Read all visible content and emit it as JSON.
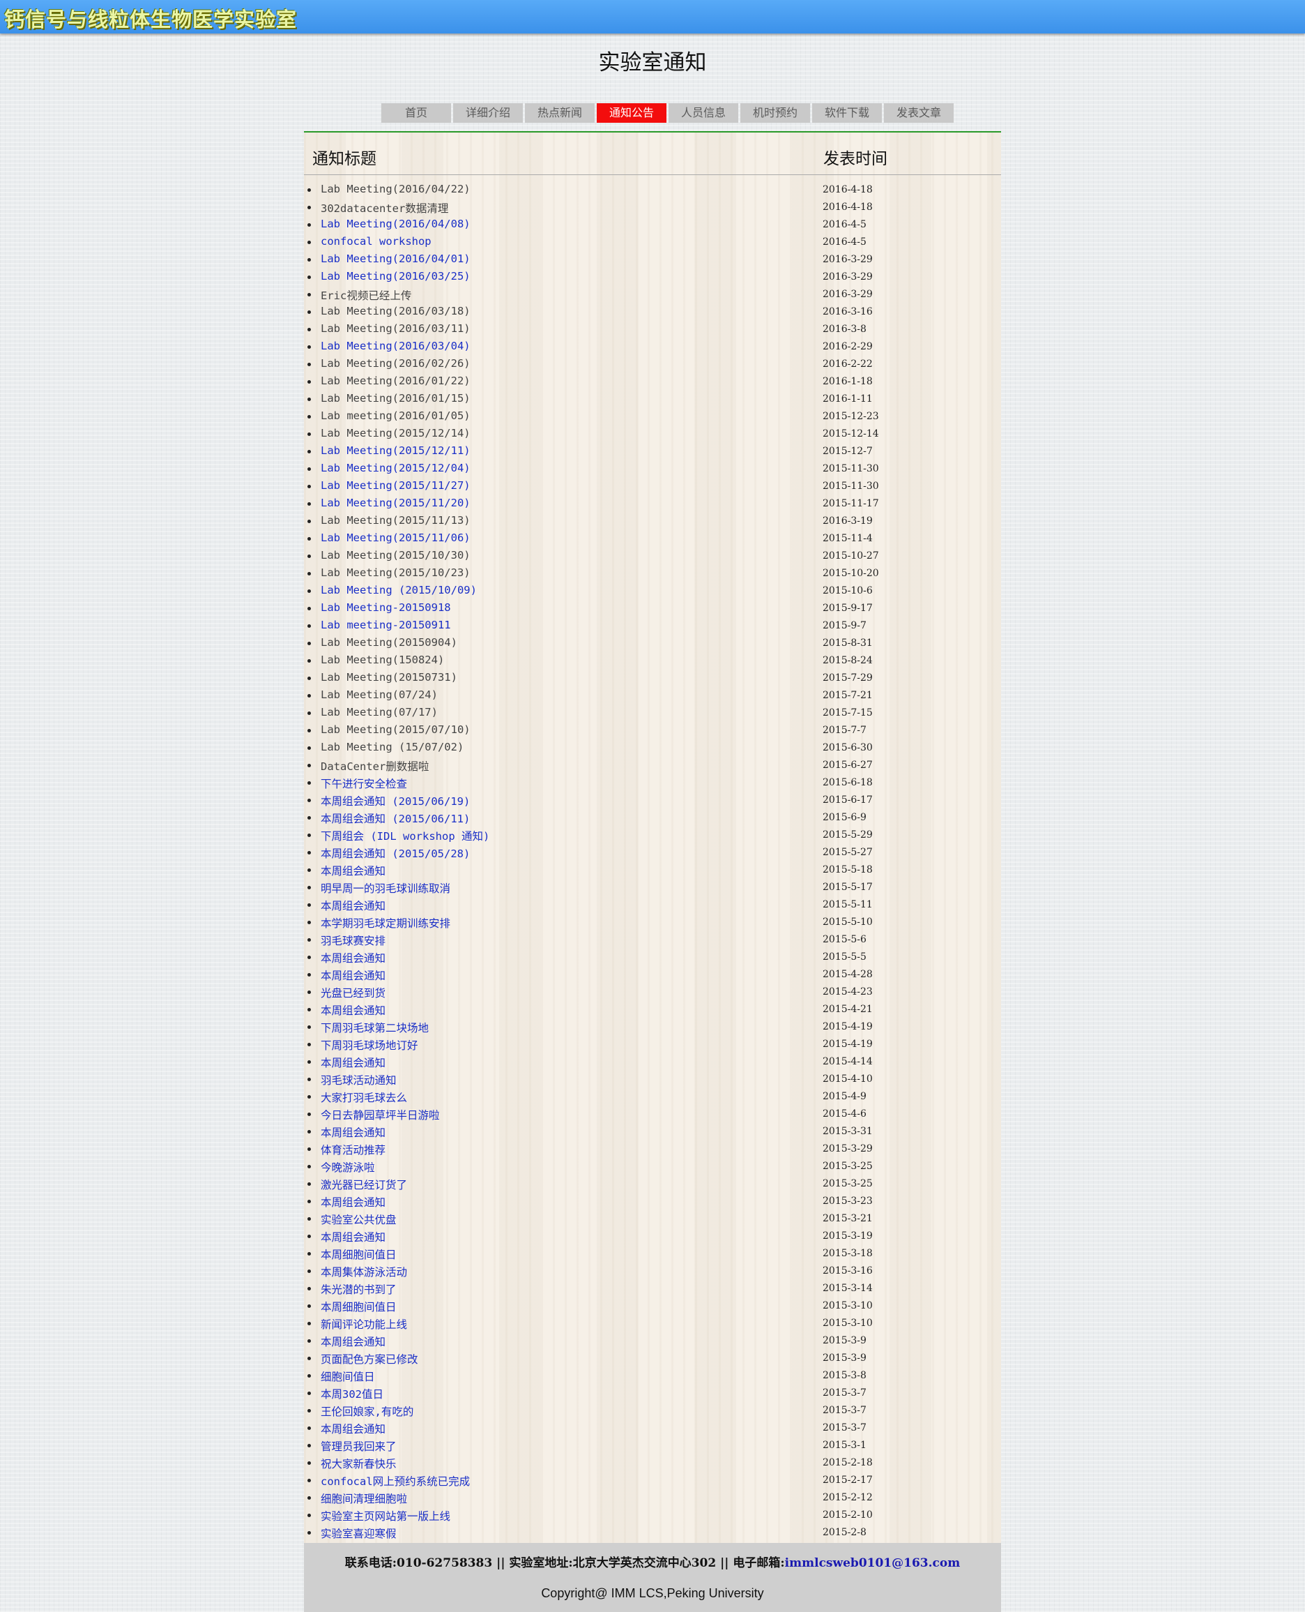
{
  "header": {
    "site_title": "钙信号与线粒体生物医学实验室"
  },
  "page_title": "实验室通知",
  "nav": [
    {
      "label": "首页",
      "active": false
    },
    {
      "label": "详细介绍",
      "active": false
    },
    {
      "label": "热点新闻",
      "active": false
    },
    {
      "label": "通知公告",
      "active": true
    },
    {
      "label": "人员信息",
      "active": false
    },
    {
      "label": "机时预约",
      "active": false
    },
    {
      "label": "软件下载",
      "active": false
    },
    {
      "label": "发表文章",
      "active": false
    }
  ],
  "table": {
    "col_title": "通知标题",
    "col_time": "发表时间"
  },
  "notices": [
    {
      "title": "Lab Meeting(2016/04/22)",
      "date": "2016-4-18",
      "link": false
    },
    {
      "title": "302datacenter数据清理",
      "date": "2016-4-18",
      "link": false
    },
    {
      "title": "Lab Meeting(2016/04/08)",
      "date": "2016-4-5",
      "link": true
    },
    {
      "title": "confocal workshop",
      "date": "2016-4-5",
      "link": true
    },
    {
      "title": "Lab Meeting(2016/04/01)",
      "date": "2016-3-29",
      "link": true
    },
    {
      "title": "Lab Meeting(2016/03/25)",
      "date": "2016-3-29",
      "link": true
    },
    {
      "title": "Eric视频已经上传",
      "date": "2016-3-29",
      "link": false
    },
    {
      "title": "Lab Meeting(2016/03/18)",
      "date": "2016-3-16",
      "link": false
    },
    {
      "title": "Lab Meeting(2016/03/11)",
      "date": "2016-3-8",
      "link": false
    },
    {
      "title": "Lab Meeting(2016/03/04)",
      "date": "2016-2-29",
      "link": true
    },
    {
      "title": "Lab Meeting(2016/02/26)",
      "date": "2016-2-22",
      "link": false
    },
    {
      "title": "Lab Meeting(2016/01/22)",
      "date": "2016-1-18",
      "link": false
    },
    {
      "title": "Lab Meeting(2016/01/15)",
      "date": "2016-1-11",
      "link": false
    },
    {
      "title": "Lab meeting(2016/01/05)",
      "date": "2015-12-23",
      "link": false
    },
    {
      "title": "Lab Meeting(2015/12/14)",
      "date": "2015-12-14",
      "link": false
    },
    {
      "title": "Lab Meeting(2015/12/11)",
      "date": "2015-12-7",
      "link": true
    },
    {
      "title": "Lab Meeting(2015/12/04)",
      "date": "2015-11-30",
      "link": true
    },
    {
      "title": "Lab Meeting(2015/11/27)",
      "date": "2015-11-30",
      "link": true
    },
    {
      "title": "Lab Meeting(2015/11/20)",
      "date": "2015-11-17",
      "link": true
    },
    {
      "title": "Lab Meeting(2015/11/13)",
      "date": "2016-3-19",
      "link": false
    },
    {
      "title": "Lab Meeting(2015/11/06)",
      "date": "2015-11-4",
      "link": true
    },
    {
      "title": "Lab Meeting(2015/10/30)",
      "date": "2015-10-27",
      "link": false
    },
    {
      "title": "Lab Meeting(2015/10/23)",
      "date": "2015-10-20",
      "link": false
    },
    {
      "title": "Lab Meeting (2015/10/09)",
      "date": "2015-10-6",
      "link": true
    },
    {
      "title": "Lab Meeting-20150918",
      "date": "2015-9-17",
      "link": true
    },
    {
      "title": "Lab meeting-20150911",
      "date": "2015-9-7",
      "link": true
    },
    {
      "title": "Lab Meeting(20150904)",
      "date": "2015-8-31",
      "link": false
    },
    {
      "title": "Lab Meeting(150824)",
      "date": "2015-8-24",
      "link": false
    },
    {
      "title": "Lab Meeting(20150731)",
      "date": "2015-7-29",
      "link": false
    },
    {
      "title": "Lab Meeting(07/24)",
      "date": "2015-7-21",
      "link": false
    },
    {
      "title": "Lab Meeting(07/17)",
      "date": "2015-7-15",
      "link": false
    },
    {
      "title": "Lab Meeting(2015/07/10)",
      "date": "2015-7-7",
      "link": false
    },
    {
      "title": "Lab Meeting (15/07/02)",
      "date": "2015-6-30",
      "link": false
    },
    {
      "title": "DataCenter删数据啦",
      "date": "2015-6-27",
      "link": false
    },
    {
      "title": "下午进行安全检查",
      "date": "2015-6-18",
      "link": true
    },
    {
      "title": "本周组会通知 (2015/06/19)",
      "date": "2015-6-17",
      "link": true
    },
    {
      "title": "本周组会通知 (2015/06/11)",
      "date": "2015-6-9",
      "link": true
    },
    {
      "title": "下周组会 (IDL workshop 通知)",
      "date": "2015-5-29",
      "link": true
    },
    {
      "title": "本周组会通知 (2015/05/28)",
      "date": "2015-5-27",
      "link": true
    },
    {
      "title": "本周组会通知",
      "date": "2015-5-18",
      "link": true
    },
    {
      "title": "明早周一的羽毛球训练取消",
      "date": "2015-5-17",
      "link": true
    },
    {
      "title": "本周组会通知",
      "date": "2015-5-11",
      "link": true
    },
    {
      "title": "本学期羽毛球定期训练安排",
      "date": "2015-5-10",
      "link": true
    },
    {
      "title": "羽毛球赛安排",
      "date": "2015-5-6",
      "link": true
    },
    {
      "title": "本周组会通知",
      "date": "2015-5-5",
      "link": true
    },
    {
      "title": "本周组会通知",
      "date": "2015-4-28",
      "link": true
    },
    {
      "title": "光盘已经到货",
      "date": "2015-4-23",
      "link": true
    },
    {
      "title": "本周组会通知",
      "date": "2015-4-21",
      "link": true
    },
    {
      "title": "下周羽毛球第二块场地",
      "date": "2015-4-19",
      "link": true
    },
    {
      "title": "下周羽毛球场地订好",
      "date": "2015-4-19",
      "link": true
    },
    {
      "title": "本周组会通知",
      "date": "2015-4-14",
      "link": true
    },
    {
      "title": "羽毛球活动通知",
      "date": "2015-4-10",
      "link": true
    },
    {
      "title": "大家打羽毛球去么",
      "date": "2015-4-9",
      "link": true
    },
    {
      "title": "今日去静园草坪半日游啦",
      "date": "2015-4-6",
      "link": true
    },
    {
      "title": "本周组会通知",
      "date": "2015-3-31",
      "link": true
    },
    {
      "title": "体育活动推荐",
      "date": "2015-3-29",
      "link": true
    },
    {
      "title": "今晚游泳啦",
      "date": "2015-3-25",
      "link": true
    },
    {
      "title": "激光器已经订货了",
      "date": "2015-3-25",
      "link": true
    },
    {
      "title": "本周组会通知",
      "date": "2015-3-23",
      "link": true
    },
    {
      "title": "实验室公共优盘",
      "date": "2015-3-21",
      "link": true
    },
    {
      "title": "本周组会通知",
      "date": "2015-3-19",
      "link": true
    },
    {
      "title": "本周细胞间值日",
      "date": "2015-3-18",
      "link": true
    },
    {
      "title": "本周集体游泳活动",
      "date": "2015-3-16",
      "link": true
    },
    {
      "title": "朱光潜的书到了",
      "date": "2015-3-14",
      "link": true
    },
    {
      "title": "本周细胞间值日",
      "date": "2015-3-10",
      "link": true
    },
    {
      "title": "新闻评论功能上线",
      "date": "2015-3-10",
      "link": true
    },
    {
      "title": "本周组会通知",
      "date": "2015-3-9",
      "link": true
    },
    {
      "title": "页面配色方案已修改",
      "date": "2015-3-9",
      "link": true
    },
    {
      "title": "细胞间值日",
      "date": "2015-3-8",
      "link": true
    },
    {
      "title": "本周302值日",
      "date": "2015-3-7",
      "link": true
    },
    {
      "title": "王伦回娘家,有吃的",
      "date": "2015-3-7",
      "link": true
    },
    {
      "title": "本周组会通知",
      "date": "2015-3-7",
      "link": true
    },
    {
      "title": "管理员我回来了",
      "date": "2015-3-1",
      "link": true
    },
    {
      "title": "祝大家新春快乐",
      "date": "2015-2-18",
      "link": true
    },
    {
      "title": "confocal网上预约系统已完成",
      "date": "2015-2-17",
      "link": true
    },
    {
      "title": "细胞间清理细胞啦",
      "date": "2015-2-12",
      "link": true
    },
    {
      "title": "实验室主页网站第一版上线",
      "date": "2015-2-10",
      "link": true
    },
    {
      "title": "实验室喜迎寒假",
      "date": "2015-2-8",
      "link": true
    }
  ],
  "footer": {
    "contact": "联系电话:010-62758383 || 实验室地址:北京大学英杰交流中心302 || 电子邮箱:",
    "email": "immlcsweb0101@163.com",
    "copyright": "Copyright@ IMM LCS,Peking University"
  },
  "colors": {
    "accent_active_tab": "#f30d0d",
    "link_blue": "#1a2fc7",
    "header_blue": "#3b91ea",
    "rule_green": "#2a9a2a"
  }
}
